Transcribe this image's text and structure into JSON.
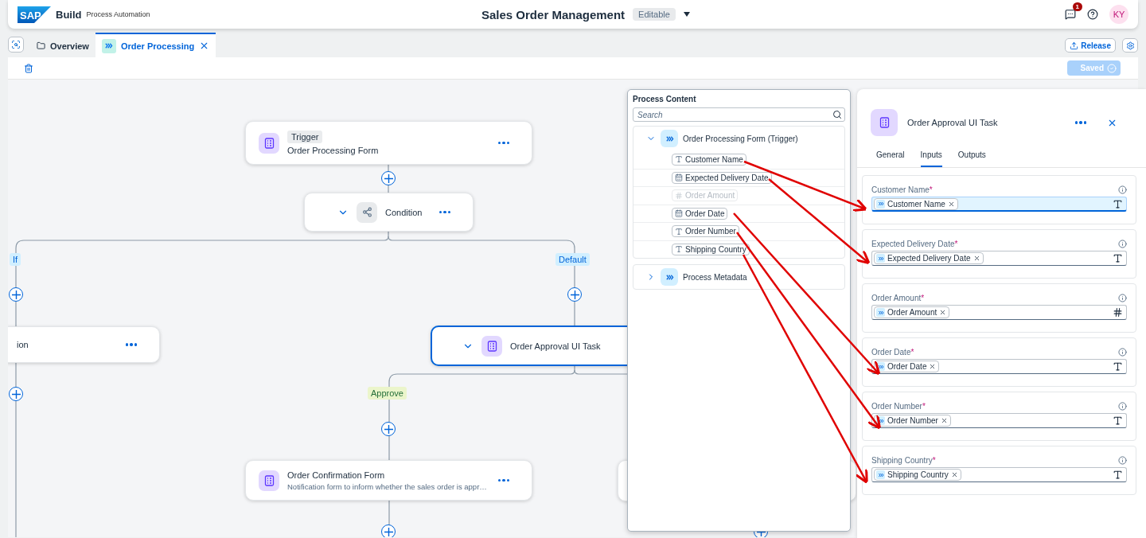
{
  "shell": {
    "logo": "SAP",
    "product": "Build",
    "subtitle": "Process Automation",
    "title": "Sales Order Management",
    "status": "Editable",
    "notifications": "1",
    "avatar": "KY"
  },
  "tabs": [
    {
      "label": "Overview",
      "selected": false
    },
    {
      "label": "Order Processing",
      "selected": true
    }
  ],
  "actions": {
    "release": "Release",
    "saved": "Saved"
  },
  "nodes": [
    {
      "kind": "trigger",
      "tag": "Trigger",
      "title": "Order Processing Form",
      "selected": false
    },
    {
      "kind": "condition",
      "title": "Condition",
      "selected": false
    },
    {
      "kind": "task",
      "title": "ion",
      "selected": false
    },
    {
      "kind": "task",
      "title": "Order Approval UI Task",
      "selected": true
    },
    {
      "kind": "form",
      "title": "Order Confirmation Form",
      "description": "Notification form to inform whether the sales order is appr…",
      "selected": false
    }
  ],
  "branch_labels": [
    {
      "label": "If",
      "kind": "condition"
    },
    {
      "label": "Default",
      "kind": "condition"
    },
    {
      "label": "Approve",
      "kind": "outcome"
    }
  ],
  "process_content": {
    "title": "Process Content",
    "placeholder": "Search",
    "groups": [
      {
        "label": "Order Processing Form (Trigger)",
        "expanded": true,
        "fields": [
          {
            "label": "Customer Name",
            "kind": "text",
            "disabled": false
          },
          {
            "label": "Expected Delivery Date",
            "kind": "date",
            "disabled": false
          },
          {
            "label": "Order Amount",
            "kind": "number",
            "disabled": true
          },
          {
            "label": "Order Date",
            "kind": "date",
            "disabled": false
          },
          {
            "label": "Order Number",
            "kind": "text",
            "disabled": false
          },
          {
            "label": "Shipping Country",
            "kind": "text",
            "disabled": false
          }
        ]
      },
      {
        "label": "Process Metadata",
        "expanded": false
      }
    ]
  },
  "details": {
    "title": "Order Approval UI Task",
    "tabs": [
      {
        "label": "General",
        "selected": false
      },
      {
        "label": "Inputs",
        "selected": true
      },
      {
        "label": "Outputs",
        "selected": false
      }
    ],
    "inputs": [
      {
        "label": "Customer Name",
        "marker": "*",
        "value": "Customer Name",
        "kind": "text",
        "focused": true
      },
      {
        "label": "Expected Delivery Date",
        "marker": "*",
        "value": "Expected Delivery Date",
        "kind": "text",
        "focused": false
      },
      {
        "label": "Order Amount",
        "marker": "*",
        "value": "Order Amount",
        "kind": "number",
        "focused": false
      },
      {
        "label": "Order Date",
        "marker": "*",
        "value": "Order Date",
        "kind": "text",
        "focused": false
      },
      {
        "label": "Order Number",
        "marker": "*",
        "value": "Order Number",
        "kind": "text",
        "focused": false
      },
      {
        "label": "Shipping Country",
        "marker": "*",
        "value": "Shipping Country",
        "kind": "text",
        "focused": false
      }
    ]
  }
}
